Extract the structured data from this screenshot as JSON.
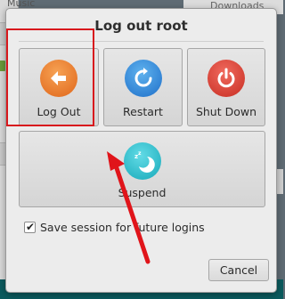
{
  "background": {
    "music_tab": "Music",
    "downloads_tab": "Downloads"
  },
  "dialog": {
    "title": "Log out root",
    "buttons": {
      "logout": {
        "label": "Log Out",
        "icon": "logout-arrow-icon",
        "color": "#e8772a"
      },
      "restart": {
        "label": "Restart",
        "icon": "restart-icon",
        "color": "#2f86da"
      },
      "shutdown": {
        "label": "Shut Down",
        "icon": "power-icon",
        "color": "#d8372c"
      },
      "suspend": {
        "label": "Suspend",
        "icon": "moon-zzz-icon",
        "color": "#2bbccc"
      }
    },
    "save_session": {
      "label": "Save session for future logins",
      "checked": true
    },
    "cancel_label": "Cancel"
  },
  "annotations": {
    "highlight_color": "#d8181d",
    "arrow_color": "#e0141a"
  }
}
